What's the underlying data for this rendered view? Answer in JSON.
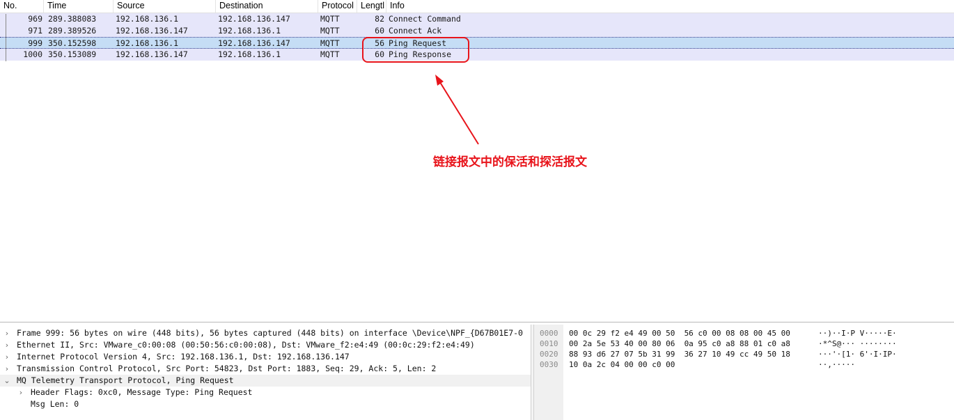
{
  "packet_list": {
    "columns": [
      "No.",
      "Time",
      "Source",
      "Destination",
      "Protocol",
      "Lengtl",
      "Info"
    ],
    "rows": [
      {
        "no": "969",
        "time": "289.388083",
        "source": "192.168.136.1",
        "destination": "192.168.136.147",
        "protocol": "MQTT",
        "length": "82",
        "info": "Connect Command"
      },
      {
        "no": "971",
        "time": "289.389526",
        "source": "192.168.136.147",
        "destination": "192.168.136.1",
        "protocol": "MQTT",
        "length": "60",
        "info": "Connect Ack"
      },
      {
        "no": "999",
        "time": "350.152598",
        "source": "192.168.136.1",
        "destination": "192.168.136.147",
        "protocol": "MQTT",
        "length": "56",
        "info": "Ping Request"
      },
      {
        "no": "1000",
        "time": "350.153089",
        "source": "192.168.136.147",
        "destination": "192.168.136.1",
        "protocol": "MQTT",
        "length": "60",
        "info": "Ping Response"
      }
    ],
    "selected_row": 2
  },
  "annotation": {
    "text": "链接报文中的保活和探活报文",
    "color": "#e8141b"
  },
  "details": {
    "rows": [
      {
        "text": "Frame 999: 56 bytes on wire (448 bits), 56 bytes captured (448 bits) on interface \\Device\\NPF_{D67B01E7-0",
        "toggle": "›",
        "indent": 0
      },
      {
        "text": "Ethernet II, Src: VMware_c0:00:08 (00:50:56:c0:00:08), Dst: VMware_f2:e4:49 (00:0c:29:f2:e4:49)",
        "toggle": "›",
        "indent": 0
      },
      {
        "text": "Internet Protocol Version 4, Src: 192.168.136.1, Dst: 192.168.136.147",
        "toggle": "›",
        "indent": 0
      },
      {
        "text": "Transmission Control Protocol, Src Port: 54823, Dst Port: 1883, Seq: 29, Ack: 5, Len: 2",
        "toggle": "›",
        "indent": 0
      },
      {
        "text": "MQ Telemetry Transport Protocol, Ping Request",
        "toggle": "⌄",
        "indent": 0
      },
      {
        "text": "Header Flags: 0xc0, Message Type: Ping Request",
        "toggle": "›",
        "indent": 1
      },
      {
        "text": "Msg Len: 0",
        "toggle": "",
        "indent": 1
      }
    ]
  },
  "bytes": {
    "rows": [
      {
        "offset": "0000",
        "hex": "00 0c 29 f2 e4 49 00 50  56 c0 00 08 08 00 45 00",
        "ascii": "··)··I·P V·····E·"
      },
      {
        "offset": "0010",
        "hex": "00 2a 5e 53 40 00 80 06  0a 95 c0 a8 88 01 c0 a8",
        "ascii": "·*^S@··· ········"
      },
      {
        "offset": "0020",
        "hex": "88 93 d6 27 07 5b 31 99  36 27 10 49 cc 49 50 18",
        "ascii": "···'·[1· 6'·I·IP·"
      },
      {
        "offset": "0030",
        "hex": "10 0a 2c 04 00 00 c0 00",
        "ascii": "··,·····"
      }
    ]
  }
}
